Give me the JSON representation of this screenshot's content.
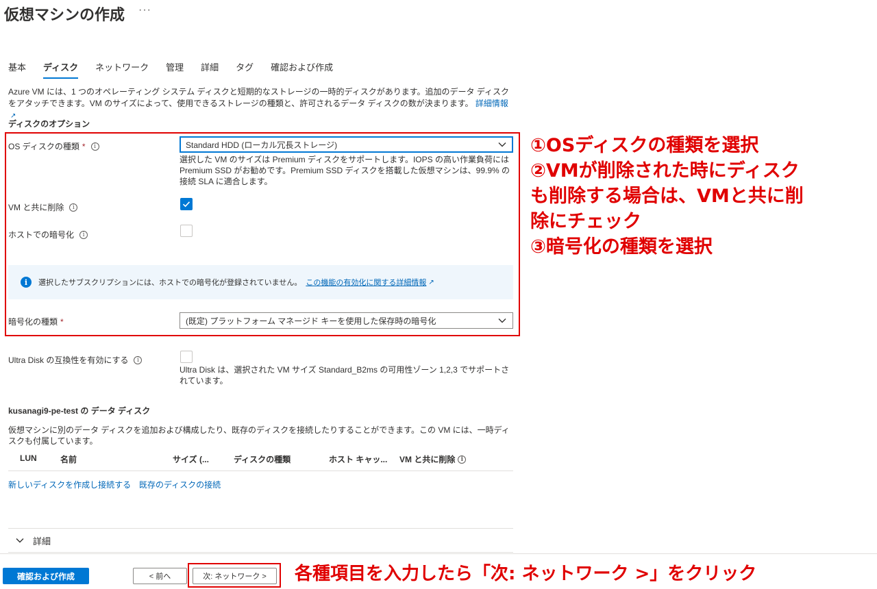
{
  "header": {
    "title": "仮想マシンの作成",
    "more": "···"
  },
  "tabs": [
    {
      "label": "基本"
    },
    {
      "label": "ディスク"
    },
    {
      "label": "ネットワーク"
    },
    {
      "label": "管理"
    },
    {
      "label": "詳細"
    },
    {
      "label": "タグ"
    },
    {
      "label": "確認および作成"
    }
  ],
  "intro": {
    "text": "Azure VM には、1 つのオペレーティング システム ディスクと短期的なストレージの一時的ディスクがあります。追加のデータ ディスクをアタッチできます。VM のサイズによって、使用できるストレージの種類と、許可されるデータ ディスクの数が決まります。",
    "link": "詳細情報"
  },
  "disk_options": {
    "heading": "ディスクのオプション",
    "os_disk_type": {
      "label": "OS ディスクの種類",
      "required": "*",
      "value": "Standard HDD (ローカル冗長ストレージ)",
      "help": "選択した VM のサイズは Premium ディスクをサポートします。IOPS の高い作業負荷には Premium SSD がお勧めです。Premium SSD ディスクを搭載した仮想マシンは、99.9% の接続 SLA に適合します。"
    },
    "delete_with_vm": {
      "label": "VM と共に削除",
      "checked": true
    },
    "host_encryption": {
      "label": "ホストでの暗号化",
      "checked": false
    },
    "info_bar": {
      "text": "選択したサブスクリプションには、ホストでの暗号化が登録されていません。",
      "link": "この機能の有効化に関する詳細情報"
    },
    "encryption_type": {
      "label": "暗号化の種類",
      "required": "*",
      "value": "(既定) プラットフォーム マネージド キーを使用した保存時の暗号化"
    },
    "ultra_disk": {
      "label": "Ultra Disk の互換性を有効にする",
      "checked": false,
      "help": "Ultra Disk は、選択された VM サイズ Standard_B2ms の可用性ゾーン 1,2,3 でサポートされています。"
    }
  },
  "data_disks": {
    "heading": "kusanagi9-pe-test の データ ディスク",
    "desc": "仮想マシンに別のデータ ディスクを追加および構成したり、既存のディスクを接続したりすることができます。この VM には、一時ディスクも付属しています。",
    "columns": [
      "LUN",
      "名前",
      "サイズ (...",
      "ディスクの種類",
      "ホスト キャッ...",
      "VM と共に削除"
    ],
    "create_link": "新しいディスクを作成し接続する",
    "attach_link": "既存のディスクの接続"
  },
  "details": {
    "label": "詳細"
  },
  "footer": {
    "review_button": "確認および作成",
    "prev_button": "< 前へ",
    "next_button": "次: ネットワーク >"
  },
  "annotations": {
    "line1": "①OSディスクの種類を選択",
    "line2": "②VMが削除された時にディスク",
    "line3": "も削除する場合は、VMと共に削",
    "line4": "除にチェック",
    "line5": "③暗号化の種類を選択",
    "footer_note": "各種項目を入力したら「次: ネットワーク >」をクリック"
  },
  "colors": {
    "accent": "#0078d4",
    "annotation": "#e00000",
    "link": "#0067b8"
  }
}
